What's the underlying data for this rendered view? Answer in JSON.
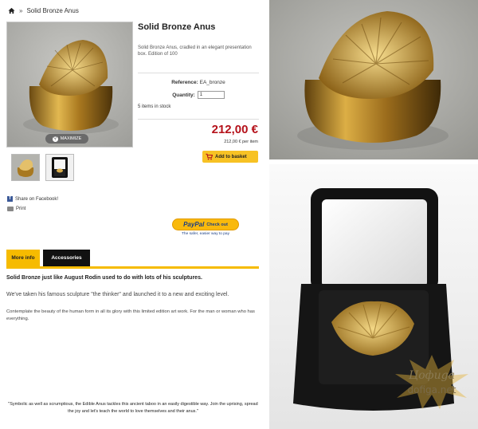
{
  "breadcrumb": {
    "current": "Solid Bronze Anus"
  },
  "product": {
    "maximize_label": "MAXIMIZE",
    "title": "Solid Bronze Anus",
    "description": "Solid Bronze Anus, cradled in an elegant presentation box. Edition of 100",
    "reference_label": "Reference:",
    "reference_value": "EA_bronze",
    "quantity_label": "Quantity:",
    "quantity_value": "1",
    "stock": "5 items in stock",
    "price": "212,00 €",
    "unit_price": "212,00 € per item",
    "add_to_basket": "Add to basket"
  },
  "social": {
    "share_facebook": "Share on Facebook!",
    "print": "Print"
  },
  "paypal": {
    "brand": "PayPal",
    "checkout": "Check out",
    "caption": "The safer, easier way to pay"
  },
  "tabs": [
    {
      "label": "More info"
    },
    {
      "label": "Accessories"
    }
  ],
  "content": {
    "headline": "Solid Bronze just like August Rodin used to do with lots of his sculptures.",
    "paragraph": "We've taken his famous sculpture \"the thinker\" and launched it to a new and exciting level.",
    "detail": "Contemplate the beauty of the human form in all its glory with this limited edition art work. For the man or woman who has everything.",
    "quote": "\"Symbolic as well as scrumptious, the Edible Anus tackles this ancient taboo in an easily digestible way. Join the uprising, spread the joy and let's teach the world to love themselves and their anus.\""
  },
  "watermark": {
    "line1": "Цофиgа",
    "line2": "dofiga.net"
  },
  "colors": {
    "accent": "#f6bb00",
    "price": "#b5121b",
    "tab_active_bg": "#111111",
    "paypal_blue": "#1b3f85"
  },
  "icons": [
    "home-icon",
    "magnifier-icon",
    "cart-icon",
    "facebook-icon",
    "printer-icon"
  ]
}
